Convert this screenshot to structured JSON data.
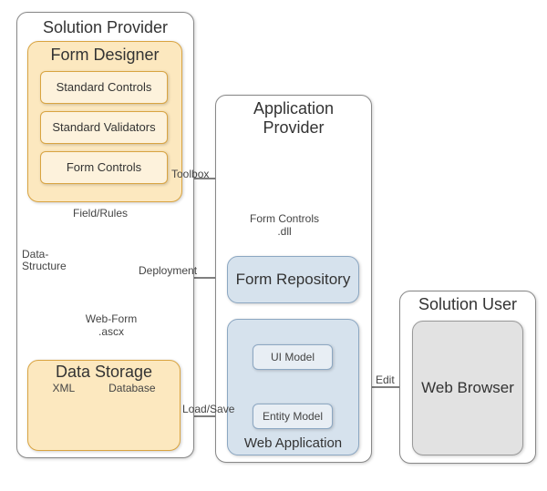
{
  "containers": {
    "solution_provider": {
      "title": "Solution Provider"
    },
    "form_designer": {
      "title": "Form Designer",
      "items": [
        "Standard Controls",
        "Standard Validators",
        "Form Controls"
      ]
    },
    "application_provider": {
      "title": "Application Provider"
    },
    "form_repository": {
      "title": "Form Repository"
    },
    "web_application": {
      "title": "Web Application",
      "ui_model": "UI Model",
      "entity_model": "Entity Model"
    },
    "solution_user": {
      "title": "Solution User",
      "web_browser": "Web Browser"
    },
    "data_storage": {
      "title": "Data Storage",
      "xml": "XML",
      "database": "Database"
    }
  },
  "artifacts": {
    "form_controls_dll": "Form Controls .dll",
    "web_form_ascx": "Web-Form .ascx"
  },
  "edges": {
    "toolbox": "Toolbox",
    "field_rules": "Field/Rules",
    "data_structure": "Data-Structure",
    "deployment": "Deployment",
    "load_save": "Load/Save",
    "edit": "Edit"
  },
  "colors": {
    "orange_bg": "#fce8bf",
    "orange_inner": "#fdf2dc",
    "orange_border": "#d9a441",
    "blue_bg": "#d6e2ed",
    "blue_inner": "#e8eef4",
    "blue_border": "#8ca7c2",
    "grey_bg": "#e2e2e2"
  },
  "chart_data": {
    "type": "diagram",
    "nodes": [
      {
        "id": "solution_provider",
        "label": "Solution Provider",
        "contains": [
          "form_designer",
          "data_storage",
          "web_form_ascx"
        ]
      },
      {
        "id": "form_designer",
        "label": "Form Designer",
        "contains": [
          "standard_controls",
          "standard_validators",
          "form_controls"
        ]
      },
      {
        "id": "standard_controls",
        "label": "Standard Controls"
      },
      {
        "id": "standard_validators",
        "label": "Standard Validators"
      },
      {
        "id": "form_controls",
        "label": "Form Controls"
      },
      {
        "id": "web_form_ascx",
        "label": "Web-Form .ascx",
        "kind": "file"
      },
      {
        "id": "data_storage",
        "label": "Data Storage",
        "contains": [
          "xml",
          "database"
        ]
      },
      {
        "id": "xml",
        "label": "XML",
        "kind": "file"
      },
      {
        "id": "database",
        "label": "Database",
        "kind": "datastore"
      },
      {
        "id": "application_provider",
        "label": "Application Provider",
        "contains": [
          "form_controls_dll",
          "form_repository",
          "web_application"
        ]
      },
      {
        "id": "form_controls_dll",
        "label": "Form Controls .dll",
        "kind": "file"
      },
      {
        "id": "form_repository",
        "label": "Form Repository"
      },
      {
        "id": "web_application",
        "label": "Web Application",
        "contains": [
          "ui_model",
          "entity_model"
        ]
      },
      {
        "id": "ui_model",
        "label": "UI Model"
      },
      {
        "id": "entity_model",
        "label": "Entity Model"
      },
      {
        "id": "solution_user",
        "label": "Solution User",
        "contains": [
          "web_browser"
        ]
      },
      {
        "id": "web_browser",
        "label": "Web Browser"
      }
    ],
    "edges": [
      {
        "from": "form_controls_dll",
        "to": "form_controls",
        "label": "Toolbox",
        "dir": "single"
      },
      {
        "from": "form_designer",
        "to": "web_form_ascx",
        "label": "Field/Rules",
        "dir": "single"
      },
      {
        "from": "form_designer",
        "to": "data_storage",
        "label": "Data-Structure",
        "dir": "single"
      },
      {
        "from": "web_form_ascx",
        "to": "form_repository",
        "label": "Deployment",
        "dir": "single"
      },
      {
        "from": "form_repository",
        "to": "ui_model",
        "label": "",
        "dir": "single"
      },
      {
        "from": "ui_model",
        "to": "entity_model",
        "label": "",
        "dir": "double"
      },
      {
        "from": "data_storage",
        "to": "entity_model",
        "label": "Load/Save",
        "dir": "double"
      },
      {
        "from": "web_application",
        "to": "web_browser",
        "label": "Edit",
        "dir": "double"
      }
    ]
  }
}
